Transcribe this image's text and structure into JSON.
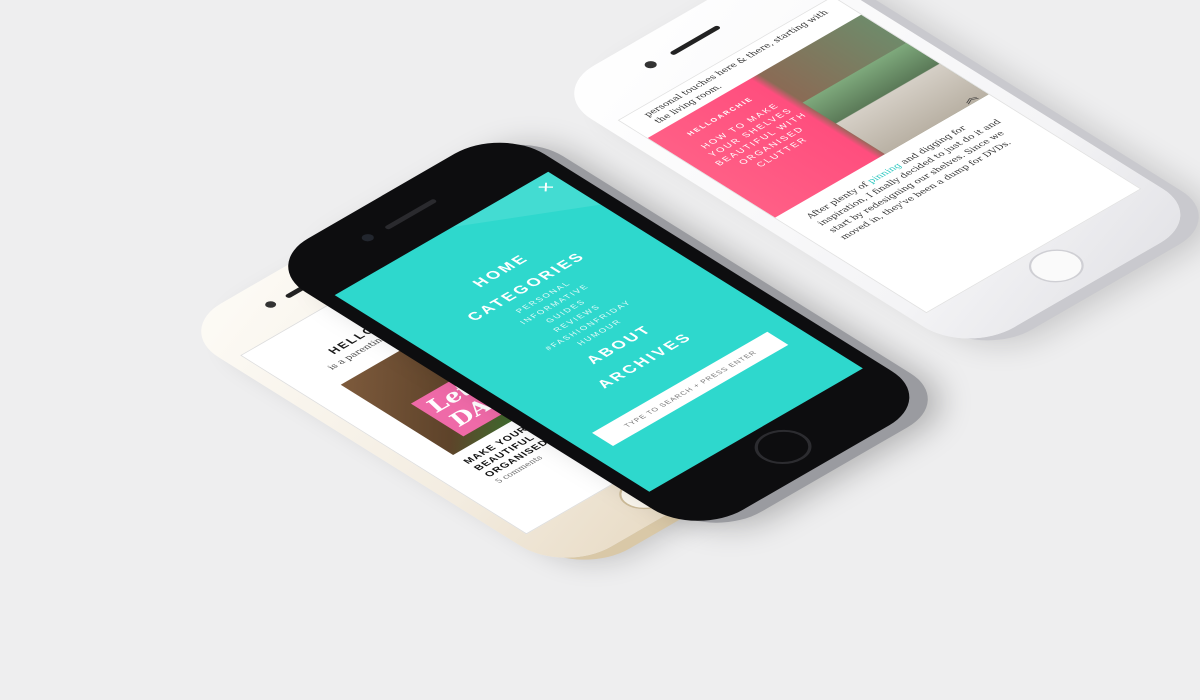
{
  "left_phone": {
    "menu_icon": "hamburger-icon",
    "brand_crown_icon": "crown-icon",
    "brand": "HELLOARCHIE",
    "tagline": "is a parenting & lifestyle blog",
    "photo_sign_text": "Let DAN",
    "post_title": "MAKE YOUR SHELVES BEAUTIFUL WITH ORGANISED CLUTTER",
    "comments": "5 comments",
    "scroll_top_icon": "chevrons-up-icon"
  },
  "center_phone": {
    "close_icon": "close-icon",
    "nav": {
      "home": "HOME",
      "categories": "CATEGORIES",
      "subcategories": [
        "PERSONAL",
        "INFORMATIVE",
        "GUIDES",
        "REVIEWS",
        "#FASHIONFRIDAY",
        "HUMOUR"
      ],
      "about": "ABOUT",
      "archives": "ARCHIVES"
    },
    "search_placeholder": "TYPE TO SEARCH + PRESS ENTER",
    "accent_color": "#2ed8cd"
  },
  "right_phone": {
    "prev_text": "personal touches here & there, starting with the living room.",
    "hero_brand": "HELLOARCHIE",
    "hero_title": "HOW TO MAKE YOUR SHELVES BEAUTIFUL WITH ORGANISED CLUTTER",
    "hero_color": "#ff5f86",
    "scroll_top_icon": "chevrons-up-icon",
    "body_before_link": "After plenty of ",
    "body_link": "pinning",
    "body_after_link": " and digging for inspiration, I finally decided to just do it and start by redesigning our shelves. Since we moved in, they've been a dump for DVDs."
  }
}
